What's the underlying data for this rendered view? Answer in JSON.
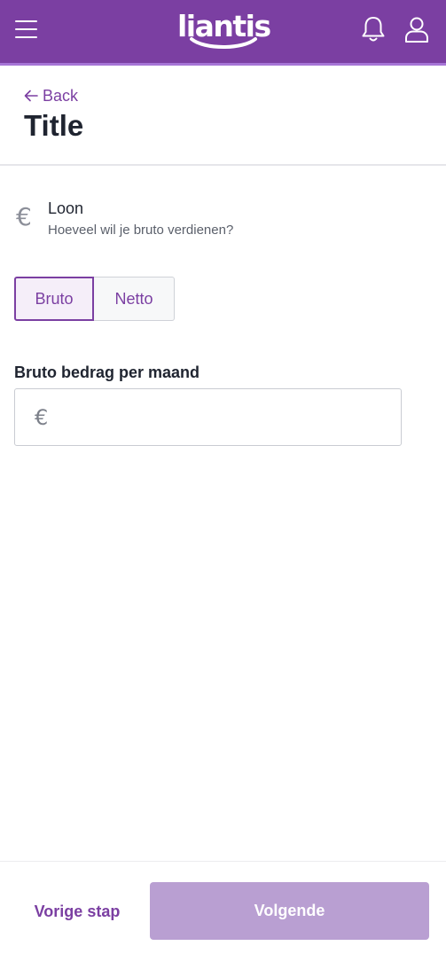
{
  "header": {
    "logo_text": "liantis",
    "menu_icon": "hamburger-menu-icon",
    "notification_icon": "bell-icon",
    "profile_icon": "user-icon",
    "brand_color": "#7b3fa2"
  },
  "nav": {
    "back_label": "Back",
    "back_icon": "arrow-left-icon"
  },
  "page": {
    "title": "Title"
  },
  "salary": {
    "icon": "euro-icon",
    "label": "Loon",
    "help": "Hoeveel wil je bruto verdienen?",
    "toggle": {
      "options": [
        "Bruto",
        "Netto"
      ],
      "selected": "Bruto"
    },
    "amount": {
      "label": "Bruto bedrag per maand",
      "currency_symbol": "€",
      "value": "",
      "placeholder": ""
    }
  },
  "footer": {
    "prev_label": "Vorige stap",
    "next_label": "Volgende",
    "next_color": "#b99fd2"
  }
}
